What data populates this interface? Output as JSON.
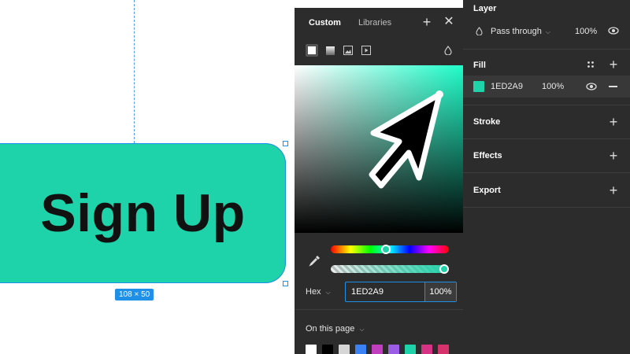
{
  "canvas": {
    "button_label": "Sign Up",
    "button_color": "#1ED2A9",
    "selection_color": "#1E90E8",
    "size_badge": "108 × 50"
  },
  "picker": {
    "tabs": [
      "Custom",
      "Libraries"
    ],
    "hue_marker_color": "#1ED2A9",
    "format_label": "Hex",
    "hex_value": "1ED2A9",
    "alpha_value": "100%",
    "page_colors_label": "On this page",
    "swatches": [
      "#ffffff",
      "#000000",
      "#d6d6d6",
      "#3b82f6",
      "#c13fbf",
      "#9b5de5",
      "#1ED2A9",
      "#d63384",
      "#d6336c"
    ]
  },
  "panel": {
    "layer_title": "Layer",
    "blend_mode": "Pass through",
    "layer_opacity": "100%",
    "fill_title": "Fill",
    "fill_hex": "1ED2A9",
    "fill_opacity": "100%",
    "stroke_title": "Stroke",
    "effects_title": "Effects",
    "export_title": "Export"
  }
}
